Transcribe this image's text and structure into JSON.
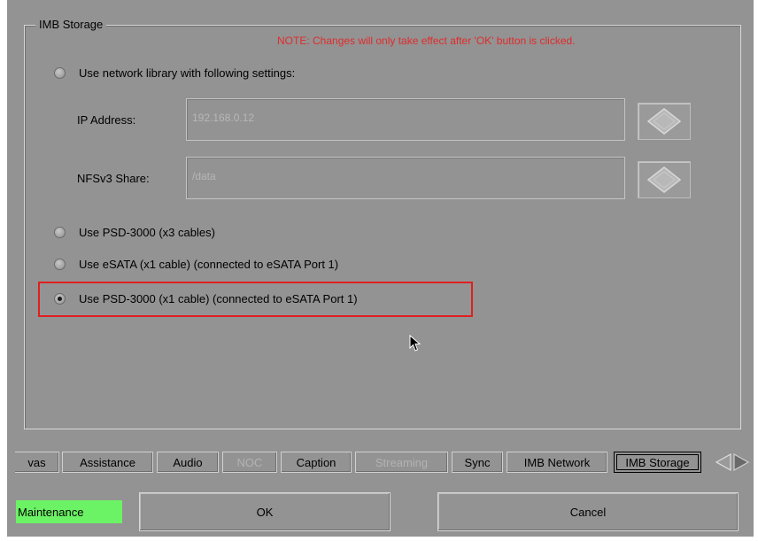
{
  "storage": {
    "group_title": "IMB Storage",
    "note": "NOTE: Changes will only take effect after 'OK' button is clicked.",
    "options": [
      {
        "label": "Use network library with following settings:",
        "checked": false
      },
      {
        "label": "Use PSD-3000 (x3 cables)",
        "checked": false
      },
      {
        "label": "Use eSATA (x1 cable)  (connected to eSATA Port 1)",
        "checked": false
      },
      {
        "label": "Use PSD-3000 (x1 cable)  (connected to eSATA Port 1)",
        "checked": true
      }
    ],
    "ip": {
      "label": "IP Address:",
      "value": "192.168.0.12"
    },
    "nfs": {
      "label": "NFSv3 Share:",
      "value": "/data"
    }
  },
  "tabs": [
    {
      "label": "vas",
      "state": "normal"
    },
    {
      "label": "Assistance",
      "state": "normal"
    },
    {
      "label": "Audio",
      "state": "normal"
    },
    {
      "label": "NOC",
      "state": "disabled"
    },
    {
      "label": "Caption",
      "state": "normal"
    },
    {
      "label": "Streaming",
      "state": "disabled"
    },
    {
      "label": "Sync",
      "state": "normal"
    },
    {
      "label": "IMB Network",
      "state": "normal"
    },
    {
      "label": "IMB Storage",
      "state": "active"
    }
  ],
  "footer": {
    "status": "Maintenance",
    "ok_label": "OK",
    "cancel_label": "Cancel"
  },
  "colors": {
    "background": "#939393",
    "note": "#e02b2b",
    "highlight": "#e01f1f",
    "status": "#6cf265"
  },
  "icons": {
    "keyboard_button": "diamond-keypad-icon",
    "cursor": "mouse-pointer-icon"
  }
}
